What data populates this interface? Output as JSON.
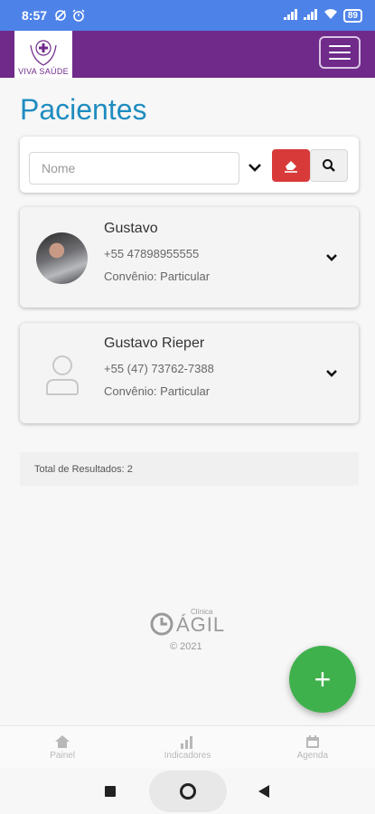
{
  "status_bar": {
    "time": "8:57",
    "battery": "89"
  },
  "header": {
    "logo_text": "VIVA SAÚDE"
  },
  "page": {
    "title": "Pacientes"
  },
  "search": {
    "placeholder": "Nome",
    "value": ""
  },
  "patients": [
    {
      "name": "Gustavo",
      "phone": "+55 47898955555",
      "plan": "Convênio: Particular"
    },
    {
      "name": "Gustavo Rieper",
      "phone": "+55 (47) 73762-7388",
      "plan": "Convênio: Particular"
    }
  ],
  "results": {
    "label": "Total de Resultados: 2"
  },
  "footer": {
    "brand": "ÁGIL",
    "brand_small": "Clínica",
    "copyright": "© 2021"
  },
  "fab": {
    "label": "+"
  },
  "bottom_nav": [
    {
      "label": "Painel",
      "icon": "home-icon"
    },
    {
      "label": "Indicadores",
      "icon": "bar-chart-icon"
    },
    {
      "label": "Agenda",
      "icon": "calendar-icon"
    }
  ],
  "colors": {
    "status_bar": "#4d83e9",
    "header": "#6f2a8a",
    "title": "#1f8cc0",
    "clear_button": "#d83a3a",
    "fab": "#3fb14c"
  }
}
